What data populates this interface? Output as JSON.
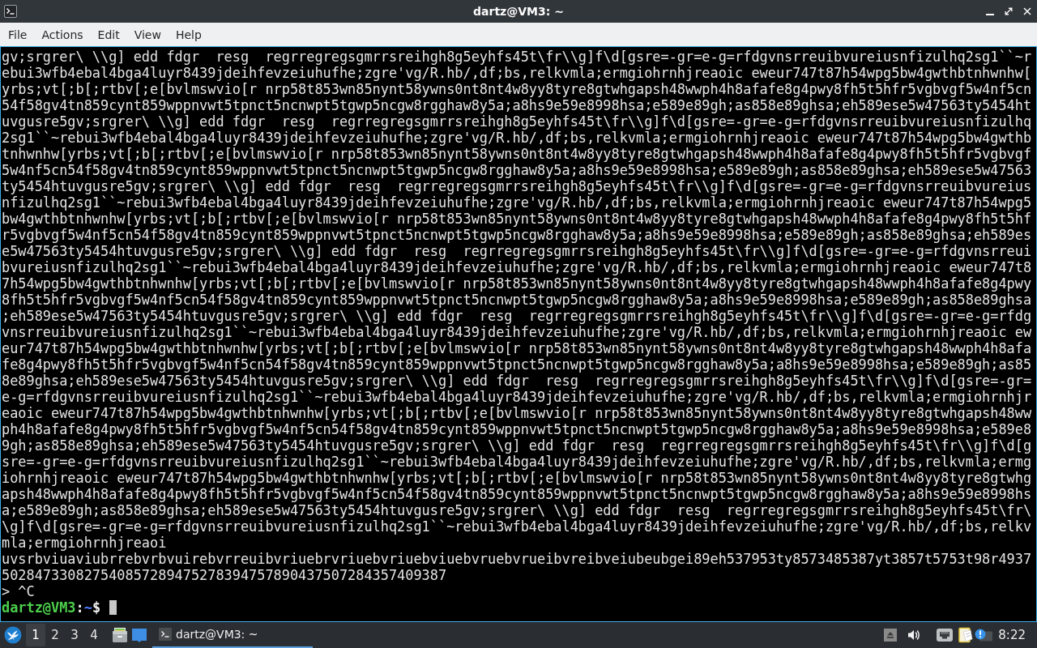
{
  "window": {
    "title": "dartz@VM3: ~"
  },
  "menu": [
    "File",
    "Actions",
    "Edit",
    "View",
    "Help"
  ],
  "terminal": {
    "lines": [
      "gv;srgrer\\ \\\\g] edd fdgr  resg  regrregregsgmrrsreihgh8g5eyhfs45t\\fr\\\\g]f\\d[gsre=-gr=e-g=rfdgvnsrreuibvureiusnfizulhq2sg1``~r",
      "ebui3wfb4ebal4bga4luyr8439jdeihfevzeiuhufhe;zgre'vg/R.hb/,df;bs,relkvmla;ermgiohrnhjreaoic eweur747t87h54wpg5bw4gwthbtnhwnhw[",
      "yrbs;vt[;b[;rtbv[;e[bvlmswvio[r nrp58t853wn85nynt58ywns0nt8nt4w8yy8tyre8gtwhgapsh48wwph4h8afafe8g4pwy8fh5t5hfr5vgbvgf5w4nf5cn",
      "54f58gv4tn859cynt859wppnvwt5tpnct5ncnwpt5tgwp5ncgw8rgghaw8y5a;a8hs9e59e8998hsa;e589e89gh;as858e89ghsa;eh589ese5w47563ty5454ht",
      "uvgusre5gv;srgrer\\ \\\\g] edd fdgr  resg  regrregregsgmrrsreihgh8g5eyhfs45t\\fr\\\\g]f\\d[gsre=-gr=e-g=rfdgvnsrreuibvureiusnfizulhq",
      "2sg1``~rebui3wfb4ebal4bga4luyr8439jdeihfevzeiuhufhe;zgre'vg/R.hb/,df;bs,relkvmla;ermgiohrnhjreaoic eweur747t87h54wpg5bw4gwthb",
      "tnhwnhw[yrbs;vt[;b[;rtbv[;e[bvlmswvio[r nrp58t853wn85nynt58ywns0nt8nt4w8yy8tyre8gtwhgapsh48wwph4h8afafe8g4pwy8fh5t5hfr5vgbvgf",
      "5w4nf5cn54f58gv4tn859cynt859wppnvwt5tpnct5ncnwpt5tgwp5ncgw8rgghaw8y5a;a8hs9e59e8998hsa;e589e89gh;as858e89ghsa;eh589ese5w47563",
      "ty5454htuvgusre5gv;srgrer\\ \\\\g] edd fdgr  resg  regrregregsgmrrsreihgh8g5eyhfs45t\\fr\\\\g]f\\d[gsre=-gr=e-g=rfdgvnsrreuibvureius",
      "nfizulhq2sg1``~rebui3wfb4ebal4bga4luyr8439jdeihfevzeiuhufhe;zgre'vg/R.hb/,df;bs,relkvmla;ermgiohrnhjreaoic eweur747t87h54wpg5",
      "bw4gwthbtnhwnhw[yrbs;vt[;b[;rtbv[;e[bvlmswvio[r nrp58t853wn85nynt58ywns0nt8nt4w8yy8tyre8gtwhgapsh48wwph4h8afafe8g4pwy8fh5t5hf",
      "r5vgbvgf5w4nf5cn54f58gv4tn859cynt859wppnvwt5tpnct5ncnwpt5tgwp5ncgw8rgghaw8y5a;a8hs9e59e8998hsa;e589e89gh;as858e89ghsa;eh589es",
      "e5w47563ty5454htuvgusre5gv;srgrer\\ \\\\g] edd fdgr  resg  regrregregsgmrrsreihgh8g5eyhfs45t\\fr\\\\g]f\\d[gsre=-gr=e-g=rfdgvnsrreui",
      "bvureiusnfizulhq2sg1``~rebui3wfb4ebal4bga4luyr8439jdeihfevzeiuhufhe;zgre'vg/R.hb/,df;bs,relkvmla;ermgiohrnhjreaoic eweur747t8",
      "7h54wpg5bw4gwthbtnhwnhw[yrbs;vt[;b[;rtbv[;e[bvlmswvio[r nrp58t853wn85nynt58ywns0nt8nt4w8yy8tyre8gtwhgapsh48wwph4h8afafe8g4pwy",
      "8fh5t5hfr5vgbvgf5w4nf5cn54f58gv4tn859cynt859wppnvwt5tpnct5ncnwpt5tgwp5ncgw8rgghaw8y5a;a8hs9e59e8998hsa;e589e89gh;as858e89ghsa",
      ";eh589ese5w47563ty5454htuvgusre5gv;srgrer\\ \\\\g] edd fdgr  resg  regrregregsgmrrsreihgh8g5eyhfs45t\\fr\\\\g]f\\d[gsre=-gr=e-g=rfdg",
      "vnsrreuibvureiusnfizulhq2sg1``~rebui3wfb4ebal4bga4luyr8439jdeihfevzeiuhufhe;zgre'vg/R.hb/,df;bs,relkvmla;ermgiohrnhjreaoic ew",
      "eur747t87h54wpg5bw4gwthbtnhwnhw[yrbs;vt[;b[;rtbv[;e[bvlmswvio[r nrp58t853wn85nynt58ywns0nt8nt4w8yy8tyre8gtwhgapsh48wwph4h8afa",
      "fe8g4pwy8fh5t5hfr5vgbvgf5w4nf5cn54f58gv4tn859cynt859wppnvwt5tpnct5ncnwpt5tgwp5ncgw8rgghaw8y5a;a8hs9e59e8998hsa;e589e89gh;as85",
      "8e89ghsa;eh589ese5w47563ty5454htuvgusre5gv;srgrer\\ \\\\g] edd fdgr  resg  regrregregsgmrrsreihgh8g5eyhfs45t\\fr\\\\g]f\\d[gsre=-gr=",
      "e-g=rfdgvnsrreuibvureiusnfizulhq2sg1``~rebui3wfb4ebal4bga4luyr8439jdeihfevzeiuhufhe;zgre'vg/R.hb/,df;bs,relkvmla;ermgiohrnhjr",
      "eaoic eweur747t87h54wpg5bw4gwthbtnhwnhw[yrbs;vt[;b[;rtbv[;e[bvlmswvio[r nrp58t853wn85nynt58ywns0nt8nt4w8yy8tyre8gtwhgapsh48ww",
      "ph4h8afafe8g4pwy8fh5t5hfr5vgbvgf5w4nf5cn54f58gv4tn859cynt859wppnvwt5tpnct5ncnwpt5tgwp5ncgw8rgghaw8y5a;a8hs9e59e8998hsa;e589e8",
      "9gh;as858e89ghsa;eh589ese5w47563ty5454htuvgusre5gv;srgrer\\ \\\\g] edd fdgr  resg  regrregregsgmrrsreihgh8g5eyhfs45t\\fr\\\\g]f\\d[g",
      "sre=-gr=e-g=rfdgvnsrreuibvureiusnfizulhq2sg1``~rebui3wfb4ebal4bga4luyr8439jdeihfevzeiuhufhe;zgre'vg/R.hb/,df;bs,relkvmla;ermg",
      "iohrnhjreaoic eweur747t87h54wpg5bw4gwthbtnhwnhw[yrbs;vt[;b[;rtbv[;e[bvlmswvio[r nrp58t853wn85nynt58ywns0nt8nt4w8yy8tyre8gtwhg",
      "apsh48wwph4h8afafe8g4pwy8fh5t5hfr5vgbvgf5w4nf5cn54f58gv4tn859cynt859wppnvwt5tpnct5ncnwpt5tgwp5ncgw8rgghaw8y5a;a8hs9e59e8998hs",
      "a;e589e89gh;as858e89ghsa;eh589ese5w47563ty5454htuvgusre5gv;srgrer\\ \\\\g] edd fdgr  resg  regrregregsgmrrsreihgh8g5eyhfs45t\\fr\\",
      "\\g]f\\d[gsre=-gr=e-g=rfdgvnsrreuibvureiusnfizulhq2sg1``~rebui3wfb4ebal4bga4luyr8439jdeihfevzeiuhufhe;zgre'vg/R.hb/,df;bs,relkv",
      "mla;ermgiohrnhjreaoi",
      "uvsrbviuaviubrrebvrbvuirebvrreuibvriuebrvriuebvriuebviuebvruebvrueibvreibveiubeubgei89eh537953ty8573485387yt3857t5753t98r4937",
      "502847330827540857289475278394757890437507284357409387",
      "> ^C"
    ],
    "prompt": {
      "user_host": "dartz@VM3",
      "separator": ":",
      "path": "~",
      "symbol": "$"
    }
  },
  "taskbar": {
    "desktops": [
      {
        "label": "1",
        "selected": true
      },
      {
        "label": "2",
        "selected": false
      },
      {
        "label": "3",
        "selected": false
      },
      {
        "label": "4",
        "selected": false
      }
    ],
    "tasks": [
      {
        "title": "dartz@VM3: ~",
        "selected": true
      }
    ],
    "clock": "8:22"
  }
}
